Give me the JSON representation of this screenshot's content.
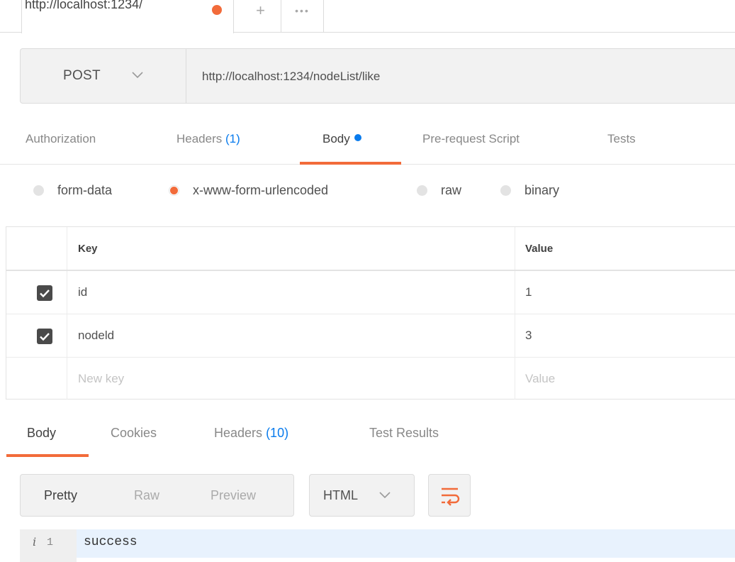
{
  "tab": {
    "label": "http://localhost:1234/",
    "new_tab_glyph": "+",
    "more_glyph": "•••"
  },
  "request": {
    "method": "POST",
    "url": "http://localhost:1234/nodeList/like"
  },
  "request_tabs": [
    {
      "label": "Authorization",
      "count": ""
    },
    {
      "label": "Headers",
      "count": "(1)"
    },
    {
      "label": "Body",
      "count": "",
      "active": true
    },
    {
      "label": "Pre-request Script",
      "count": ""
    },
    {
      "label": "Tests",
      "count": ""
    }
  ],
  "body_types": [
    {
      "label": "form-data",
      "selected": false
    },
    {
      "label": "x-www-form-urlencoded",
      "selected": true
    },
    {
      "label": "raw",
      "selected": false
    },
    {
      "label": "binary",
      "selected": false
    }
  ],
  "params_table": {
    "headers": {
      "key": "Key",
      "value": "Value"
    },
    "rows": [
      {
        "checked": true,
        "key": "id",
        "value": "1"
      },
      {
        "checked": true,
        "key": "nodeld",
        "value": "3"
      }
    ],
    "placeholder": {
      "key": "New key",
      "value": "Value"
    }
  },
  "response_tabs": [
    {
      "label": "Body",
      "count": "",
      "active": true
    },
    {
      "label": "Cookies",
      "count": ""
    },
    {
      "label": "Headers",
      "count": "(10)"
    },
    {
      "label": "Test Results",
      "count": ""
    }
  ],
  "view_modes": [
    {
      "label": "Pretty",
      "active": true
    },
    {
      "label": "Raw",
      "active": false
    },
    {
      "label": "Preview",
      "active": false
    }
  ],
  "format": "HTML",
  "response_body": {
    "info_glyph": "i",
    "line_number": "1",
    "text": "success"
  },
  "colors": {
    "accent": "#f26b3a",
    "link": "#097bed"
  }
}
